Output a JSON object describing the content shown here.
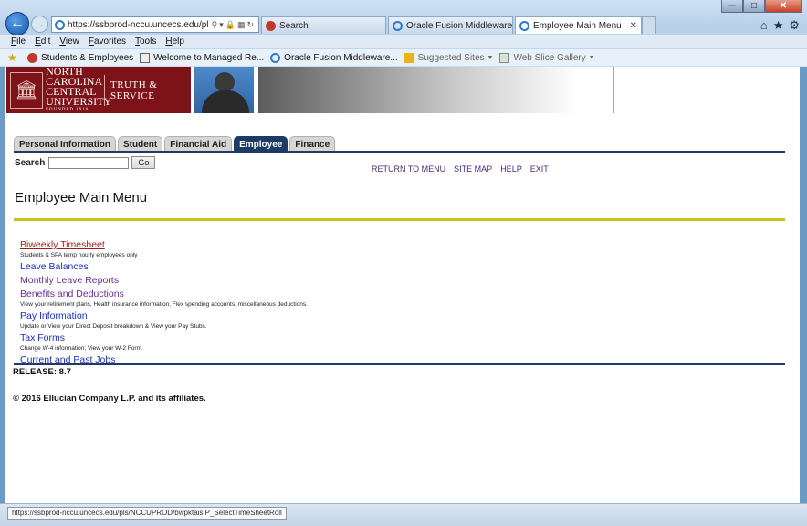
{
  "browser": {
    "address_url": "https://ssbprod-nccu.uncecs.edu/pls/NC",
    "tabs": [
      {
        "label": "Search"
      },
      {
        "label": "Oracle Fusion Middleware For..."
      },
      {
        "label": "Employee Main Menu"
      }
    ],
    "menu": [
      "File",
      "Edit",
      "View",
      "Favorites",
      "Tools",
      "Help"
    ],
    "favorites": [
      {
        "label": "Students & Employees"
      },
      {
        "label": "Welcome to Managed Re..."
      },
      {
        "label": "Oracle Fusion Middleware..."
      },
      {
        "label": "Suggested Sites"
      },
      {
        "label": "Web Slice Gallery"
      }
    ],
    "status_url": "https://ssbprod-nccu.uncecs.edu/pls/NCCUPROD/bwpktais.P_SelectTimeSheetRoll",
    "colors": {
      "chrome": "#c9dcf0",
      "close": "#c5422a"
    }
  },
  "banner": {
    "university_name": "NORTH CAROLINA CENTRAL UNIVERSITY",
    "founded": "FOUNDED 1910",
    "motto": "TRUTH & SERVICE",
    "brand_color": "#7d1318"
  },
  "nav_tabs": [
    {
      "label": "Personal Information",
      "active": false
    },
    {
      "label": "Student",
      "active": false
    },
    {
      "label": "Financial Aid",
      "active": false
    },
    {
      "label": "Employee",
      "active": true
    },
    {
      "label": "Finance",
      "active": false
    }
  ],
  "search": {
    "label": "Search",
    "value": "",
    "button": "Go"
  },
  "top_links": [
    "RETURN TO MENU",
    "SITE MAP",
    "HELP",
    "EXIT"
  ],
  "page_title": "Employee Main Menu",
  "menu_items": [
    {
      "label": "Biweekly Timesheet",
      "desc": "Students & SPA temp hourly employees only",
      "state": "hover"
    },
    {
      "label": "Leave Balances",
      "desc": "",
      "state": "link"
    },
    {
      "label": "Monthly Leave Reports",
      "desc": "",
      "state": "visited"
    },
    {
      "label": "Benefits and Deductions",
      "desc": "View your retirement plans, Health insurance information, Flex spending accounts, miscellaneous deductions.",
      "state": "visited"
    },
    {
      "label": "Pay Information",
      "desc": "Update or View your Direct Deposit breakdown & View your Pay Stubs.",
      "state": "link"
    },
    {
      "label": "Tax Forms",
      "desc": "Change W-4 information; View your W-2 Form.",
      "state": "link"
    },
    {
      "label": "Current and Past Jobs",
      "desc": "",
      "state": "link"
    }
  ],
  "release": "RELEASE: 8.7",
  "copyright": "© 2016 Ellucian Company L.P. and its affiliates.",
  "colors": {
    "nav_active": "#1d3b66",
    "gold_rule": "#c9c316",
    "link": "#1a2fbf",
    "visited": "#6a2e98"
  }
}
